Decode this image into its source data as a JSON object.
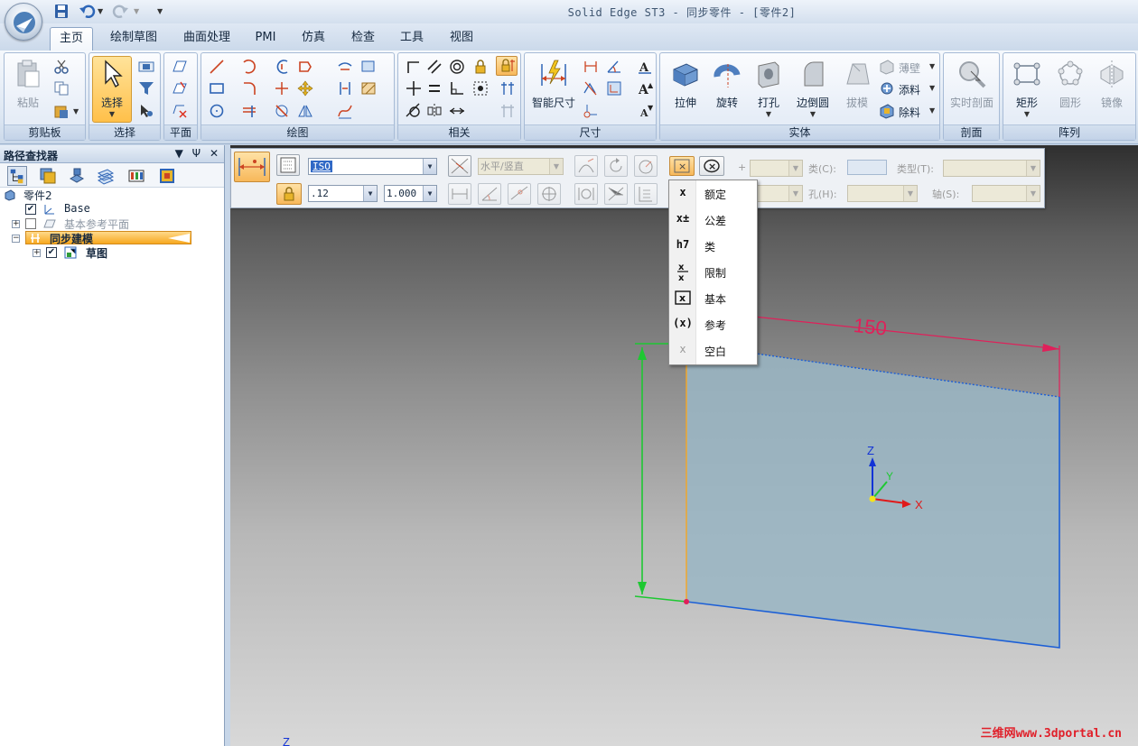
{
  "window": {
    "title": "Solid Edge ST3 - 同步零件 - [零件2]"
  },
  "ribbon": {
    "tabs": [
      "主页",
      "绘制草图",
      "曲面处理",
      "PMI",
      "仿真",
      "检查",
      "工具",
      "视图"
    ],
    "active_tab": "主页",
    "groups": {
      "clipboard": {
        "label": "剪贴板",
        "paste": "粘贴"
      },
      "select": {
        "label": "选择",
        "select": "选择"
      },
      "plane": {
        "label": "平面"
      },
      "draw": {
        "label": "绘图"
      },
      "relate": {
        "label": "相关"
      },
      "dimension": {
        "label": "尺寸",
        "smart_dim": "智能尺寸"
      },
      "solid": {
        "label": "实体",
        "extrude": "拉伸",
        "revolve": "旋转",
        "hole": "打孔",
        "round": "边倒圆",
        "draft": "拔模",
        "thin_wall": "薄壁",
        "add": "添料",
        "cut": "除料"
      },
      "section": {
        "label": "剖面",
        "live_section": "实时剖面"
      },
      "pattern": {
        "label": "阵列",
        "rectangular": "矩形",
        "circular": "圆形",
        "mirror": "镜像"
      }
    }
  },
  "pathfinder": {
    "title": "路径查找器",
    "controls": [
      "▼",
      "Ψ",
      "✕"
    ],
    "tree": [
      {
        "label": "零件2",
        "level": 0
      },
      {
        "label": "Base",
        "level": 1,
        "checked": true
      },
      {
        "label": "基本参考平面",
        "level": 1,
        "checked": false,
        "dimmed": true
      },
      {
        "label": "同步建模",
        "level": 1,
        "highlighted": true
      },
      {
        "label": "草图",
        "level": 2,
        "checked": true
      }
    ]
  },
  "command_bar": {
    "style": "ISO",
    "orientation": "水平/竖直",
    "precision": ".12",
    "scale": "1.000",
    "plus_label": "+",
    "class_label": "类(C):",
    "type_label": "类型(T):",
    "hole_label": "孔(H):",
    "shaft_label": "轴(S):"
  },
  "dim_type_menu": {
    "items": [
      {
        "icon": "x",
        "label": "额定"
      },
      {
        "icon": "x±",
        "label": "公差"
      },
      {
        "icon": "h7",
        "label": "类"
      },
      {
        "icon": "x/x",
        "label": "限制"
      },
      {
        "icon": "[x]",
        "label": "基本"
      },
      {
        "icon": "(x)",
        "label": "参考"
      },
      {
        "icon": "x",
        "label": "空白"
      }
    ]
  },
  "viewport": {
    "dimension_value": "150",
    "axes": {
      "x": "X",
      "y": "Y",
      "z": "Z"
    },
    "corner_axis": "Z",
    "watermark": "三维网www.3dportal.cn"
  },
  "colors": {
    "accent": "#ffc04a",
    "dimension": "#e0205a",
    "sketch_edge": "#1c5fd6",
    "constraint": "#1ec832",
    "face": "#9ab6c4"
  }
}
